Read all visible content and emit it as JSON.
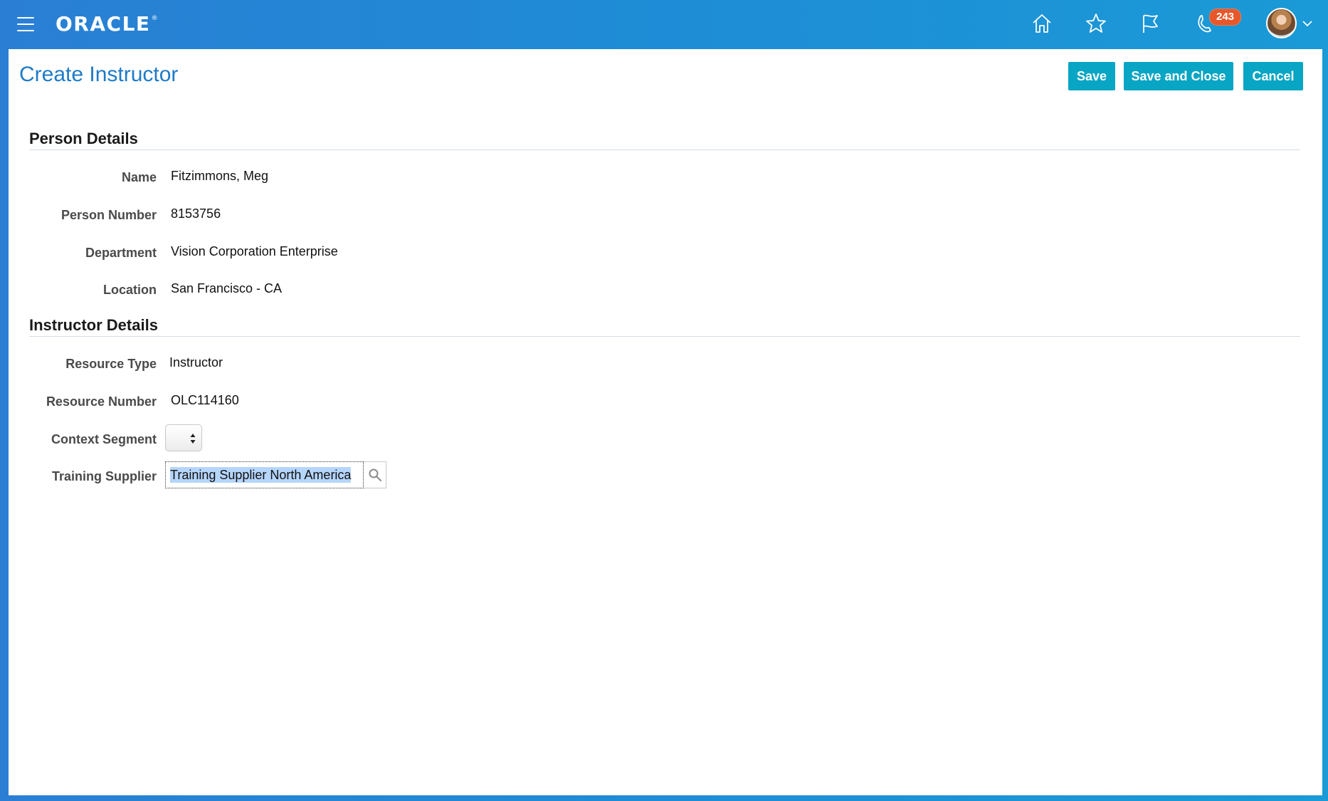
{
  "header": {
    "brand": "ORACLE",
    "brand_mark": "®",
    "notification_count": "243",
    "icons": [
      "menu-icon",
      "home-icon",
      "star-icon",
      "flag-icon",
      "notifications-icon",
      "avatar",
      "chevron-down-icon"
    ]
  },
  "page": {
    "title": "Create Instructor",
    "buttons": {
      "save": "Save",
      "save_and_close": "Save and Close",
      "cancel": "Cancel"
    }
  },
  "person_details": {
    "title": "Person Details",
    "fields": [
      {
        "label": "Name",
        "value": "Fitzimmons, Meg"
      },
      {
        "label": "Person Number",
        "value": "8153756"
      },
      {
        "label": "Department",
        "value": "Vision Corporation Enterprise"
      },
      {
        "label": "Location",
        "value": "San Francisco - CA"
      }
    ]
  },
  "instructor_details": {
    "title": "Instructor Details",
    "resource_type": {
      "label": "Resource Type",
      "value": "Instructor"
    },
    "resource_number": {
      "label": "Resource Number",
      "value": "OLC114160"
    },
    "context_segment": {
      "label": "Context Segment",
      "value": ""
    },
    "training_supplier": {
      "label": "Training Supplier",
      "value": "Training Supplier North America"
    }
  },
  "colors": {
    "header_gradient_start": "#2a7fd4",
    "header_gradient_end": "#1a9ad6",
    "button": "#08a5c4",
    "title": "#1d7bc8",
    "badge": "#e8572a",
    "selection": "#b5d5fb"
  }
}
